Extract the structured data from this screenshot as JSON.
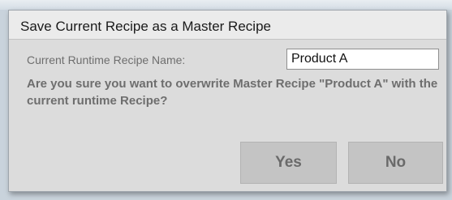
{
  "dialog": {
    "title": "Save Current Recipe as a Master Recipe",
    "field_label": "Current Runtime Recipe Name:",
    "field_value": "Product A",
    "message": "Are you sure you want to overwrite Master Recipe \"Product A\" with the current runtime Recipe?",
    "yes_label": "Yes",
    "no_label": "No"
  },
  "background": {
    "top_text": "",
    "bottom_text": ""
  }
}
